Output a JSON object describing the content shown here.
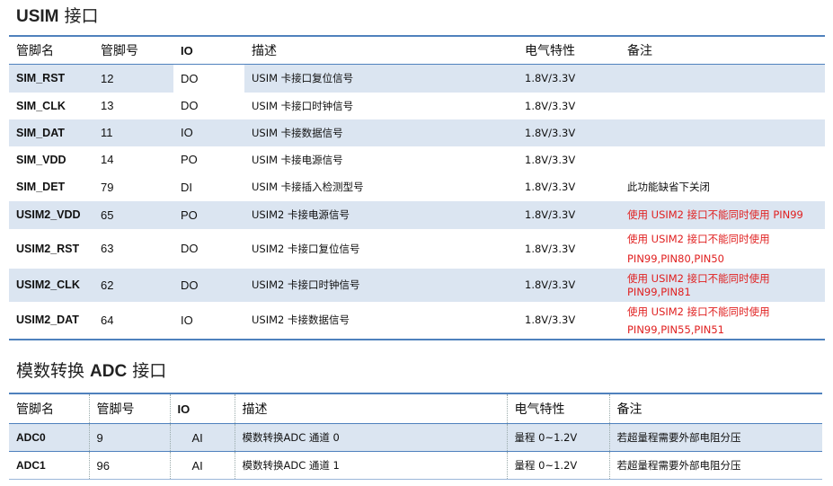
{
  "usim": {
    "title_bold": "USIM",
    "title_rest": " 接口",
    "headers": [
      "管脚名",
      "管脚号",
      "IO",
      "描述",
      "电气特性",
      "备注"
    ],
    "rows": [
      {
        "name": "SIM_RST",
        "pin": "12",
        "io": "DO",
        "desc": "USIM 卡接口复位信号",
        "elec": "1.8V/3.3V",
        "note": ""
      },
      {
        "name": "SIM_CLK",
        "pin": "13",
        "io": "DO",
        "desc": "USIM 卡接口时钟信号",
        "elec": "1.8V/3.3V",
        "note": ""
      },
      {
        "name": "SIM_DAT",
        "pin": "11",
        "io": "IO",
        "desc": "USIM 卡接数据信号",
        "elec": "1.8V/3.3V",
        "note": ""
      },
      {
        "name": "SIM_VDD",
        "pin": "14",
        "io": "PO",
        "desc": "USIM 卡接电源信号",
        "elec": "1.8V/3.3V",
        "note": ""
      },
      {
        "name": "SIM_DET",
        "pin": "79",
        "io": "DI",
        "desc": "USIM 卡接插入检测型号",
        "elec": "1.8V/3.3V",
        "note": "此功能缺省下关闭"
      },
      {
        "name": "USIM2_VDD",
        "pin": "65",
        "io": "PO",
        "desc": "USIM2 卡接电源信号",
        "elec": "1.8V/3.3V",
        "note": "使用 USIM2 接口不能同时使用 PIN99"
      },
      {
        "name": "USIM2_RST",
        "pin": "63",
        "io": "DO",
        "desc": "USIM2 卡接口复位信号",
        "elec": "1.8V/3.3V",
        "note_line1": "使用 USIM2 接口不能同时使用",
        "note_line2": "PIN99,PIN80,PIN50"
      },
      {
        "name": "USIM2_CLK",
        "pin": "62",
        "io": "DO",
        "desc": "USIM2 卡接口时钟信号",
        "elec": "1.8V/3.3V",
        "note_line1": "使用 USIM2 接口不能同时使用",
        "note_line2": "PIN99,PIN81"
      },
      {
        "name": "USIM2_DAT",
        "pin": "64",
        "io": "IO",
        "desc": "USIM2 卡接数据信号",
        "elec": "1.8V/3.3V",
        "note_line1": "使用 USIM2 接口不能同时使用",
        "note_line2": "PIN99,PIN55,PIN51"
      }
    ]
  },
  "adc": {
    "title_pre": "模数转换 ",
    "title_bold": "ADC",
    "title_rest": " 接口",
    "headers": [
      "管脚名",
      "管脚号",
      "IO",
      "描述",
      "电气特性",
      "备注"
    ],
    "rows": [
      {
        "name": "ADC0",
        "pin": "9",
        "io": "AI",
        "desc": "模数转换ADC 通道 0",
        "elec": "量程 0~1.2V",
        "note": "若超量程需要外部电阻分压"
      },
      {
        "name": "ADC1",
        "pin": "96",
        "io": "AI",
        "desc": "模数转换ADC 通道 1",
        "elec": "量程 0~1.2V",
        "note": "若超量程需要外部电阻分压"
      }
    ]
  },
  "colors": {
    "accent": "#4f81bd",
    "band": "#dbe5f1",
    "note_red": "#e02020"
  }
}
